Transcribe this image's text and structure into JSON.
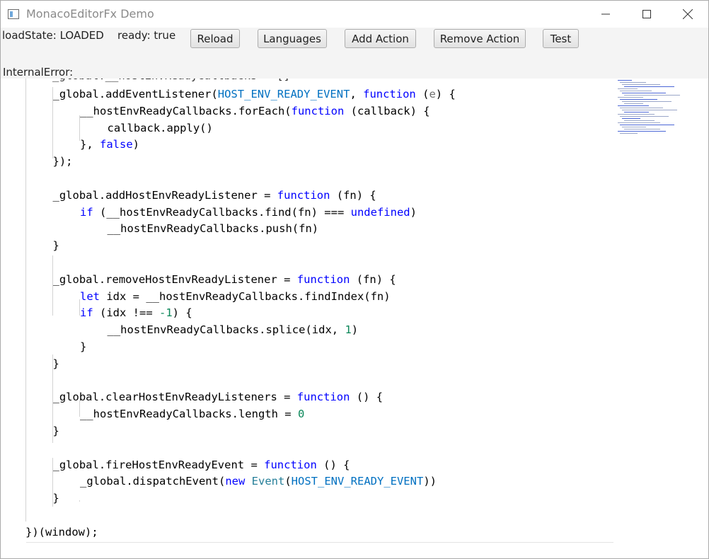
{
  "window": {
    "title": "MonacoEditorFx Demo"
  },
  "toolbar": {
    "load_state": "loadState: LOADED",
    "ready": "ready: true",
    "buttons": {
      "reload": "Reload",
      "languages": "Languages",
      "add_action": "Add Action",
      "remove_action": "Remove Action",
      "test": "Test"
    },
    "internal_error": "InternalError:"
  },
  "editor": {
    "partial_top_line": "_global.__hostEnvReadyCallbacks = []",
    "lines": [
      {
        "tokens": [
          {
            "t": "_global.addEventListener("
          },
          {
            "t": "HOST_ENV_READY_EVENT",
            "c": "cn"
          },
          {
            "t": ", "
          },
          {
            "t": "function",
            "c": "kw"
          },
          {
            "t": " ("
          },
          {
            "t": "e",
            "c": "pm"
          },
          {
            "t": ") {"
          }
        ]
      },
      {
        "tokens": [
          {
            "t": "__hostEnvReadyCallbacks.forEach("
          },
          {
            "t": "function",
            "c": "kw"
          },
          {
            "t": " (callback) {"
          }
        ]
      },
      {
        "tokens": [
          {
            "t": "callback.apply()"
          }
        ]
      },
      {
        "tokens": [
          {
            "t": "}, "
          },
          {
            "t": "false",
            "c": "kw"
          },
          {
            "t": ")"
          }
        ]
      },
      {
        "tokens": [
          {
            "t": "});"
          }
        ]
      },
      {
        "tokens": []
      },
      {
        "tokens": [
          {
            "t": "_global.addHostEnvReadyListener = "
          },
          {
            "t": "function",
            "c": "kw"
          },
          {
            "t": " (fn) {"
          }
        ]
      },
      {
        "tokens": [
          {
            "t": "if",
            "c": "kw"
          },
          {
            "t": " (__hostEnvReadyCallbacks.find(fn) === "
          },
          {
            "t": "undefined",
            "c": "kw"
          },
          {
            "t": ")"
          }
        ]
      },
      {
        "tokens": [
          {
            "t": "__hostEnvReadyCallbacks.push(fn)"
          }
        ]
      },
      {
        "tokens": [
          {
            "t": "}"
          }
        ]
      },
      {
        "tokens": []
      },
      {
        "tokens": [
          {
            "t": "_global.removeHostEnvReadyListener = "
          },
          {
            "t": "function",
            "c": "kw"
          },
          {
            "t": " (fn) {"
          }
        ]
      },
      {
        "tokens": [
          {
            "t": "let",
            "c": "kw"
          },
          {
            "t": " idx = __hostEnvReadyCallbacks.findIndex(fn)"
          }
        ]
      },
      {
        "tokens": [
          {
            "t": "if",
            "c": "kw"
          },
          {
            "t": " (idx !== "
          },
          {
            "t": "-1",
            "c": "nm"
          },
          {
            "t": ") {"
          }
        ]
      },
      {
        "tokens": [
          {
            "t": "__hostEnvReadyCallbacks.splice(idx, "
          },
          {
            "t": "1",
            "c": "nm"
          },
          {
            "t": ")"
          }
        ]
      },
      {
        "tokens": [
          {
            "t": "}"
          }
        ]
      },
      {
        "tokens": [
          {
            "t": "}"
          }
        ]
      },
      {
        "tokens": []
      },
      {
        "tokens": [
          {
            "t": "_global.clearHostEnvReadyListeners = "
          },
          {
            "t": "function",
            "c": "kw"
          },
          {
            "t": " () {"
          }
        ]
      },
      {
        "tokens": [
          {
            "t": "__hostEnvReadyCallbacks.length = "
          },
          {
            "t": "0",
            "c": "nm"
          }
        ]
      },
      {
        "tokens": [
          {
            "t": "}"
          }
        ]
      },
      {
        "tokens": []
      },
      {
        "tokens": [
          {
            "t": "_global.fireHostEnvReadyEvent = "
          },
          {
            "t": "function",
            "c": "kw"
          },
          {
            "t": " () {"
          }
        ]
      },
      {
        "tokens": [
          {
            "t": "_global.dispatchEvent("
          },
          {
            "t": "new",
            "c": "kw"
          },
          {
            "t": " "
          },
          {
            "t": "Event",
            "c": "ty"
          },
          {
            "t": "("
          },
          {
            "t": "HOST_ENV_READY_EVENT",
            "c": "cn"
          },
          {
            "t": "))"
          }
        ]
      },
      {
        "tokens": [
          {
            "t": "}"
          }
        ]
      },
      {
        "tokens": []
      },
      {
        "tokens": [
          {
            "t": "})(window);"
          }
        ]
      }
    ]
  },
  "colors": {
    "keyword": "#0000ff",
    "constant": "#0070c1",
    "type": "#267f99",
    "number": "#098658",
    "param": "#6f6f6f",
    "toolbar_bg": "#f4f4f4"
  },
  "icons": {
    "app": "app-window-icon",
    "minimize": "minimize-icon",
    "maximize": "maximize-icon",
    "close": "close-icon"
  }
}
